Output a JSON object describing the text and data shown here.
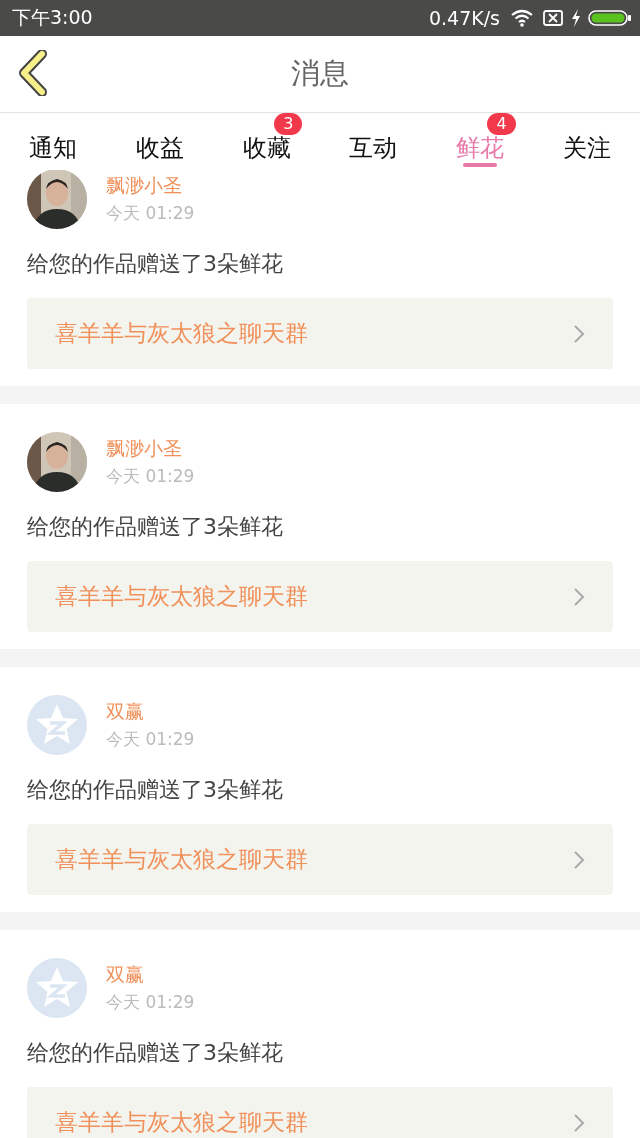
{
  "status_bar": {
    "time": "下午3:00",
    "speed": "0.47K/s"
  },
  "header": {
    "title": "消息"
  },
  "tabs": [
    {
      "label": "通知",
      "selected": false
    },
    {
      "label": "收益",
      "selected": false
    },
    {
      "label": "收藏",
      "selected": false,
      "badge": "3"
    },
    {
      "label": "互动",
      "selected": false
    },
    {
      "label": "鲜花",
      "selected": true,
      "badge": "4"
    },
    {
      "label": "关注",
      "selected": false
    }
  ],
  "messages": [
    {
      "name": "飘渺小圣",
      "time": "今天 01:29",
      "text": "给您的作品赠送了3朵鲜花",
      "link": "喜羊羊与灰太狼之聊天群"
    },
    {
      "name": "飘渺小圣",
      "time": "今天 01:29",
      "text": "给您的作品赠送了3朵鲜花",
      "link": "喜羊羊与灰太狼之聊天群"
    },
    {
      "avatar": {
        "kind": "default"
      },
      "name": "双赢",
      "time": "今天 01:29",
      "text": "给您的作品赠送了3朵鲜花",
      "link": "喜羊羊与灰太狼之聊天群"
    },
    {
      "avatar": {
        "kind": "default"
      },
      "name": "双赢",
      "time": "今天 01:29",
      "text": "给您的作品赠送了3朵鲜花",
      "link": "喜羊羊与灰太狼之聊天群"
    }
  ]
}
